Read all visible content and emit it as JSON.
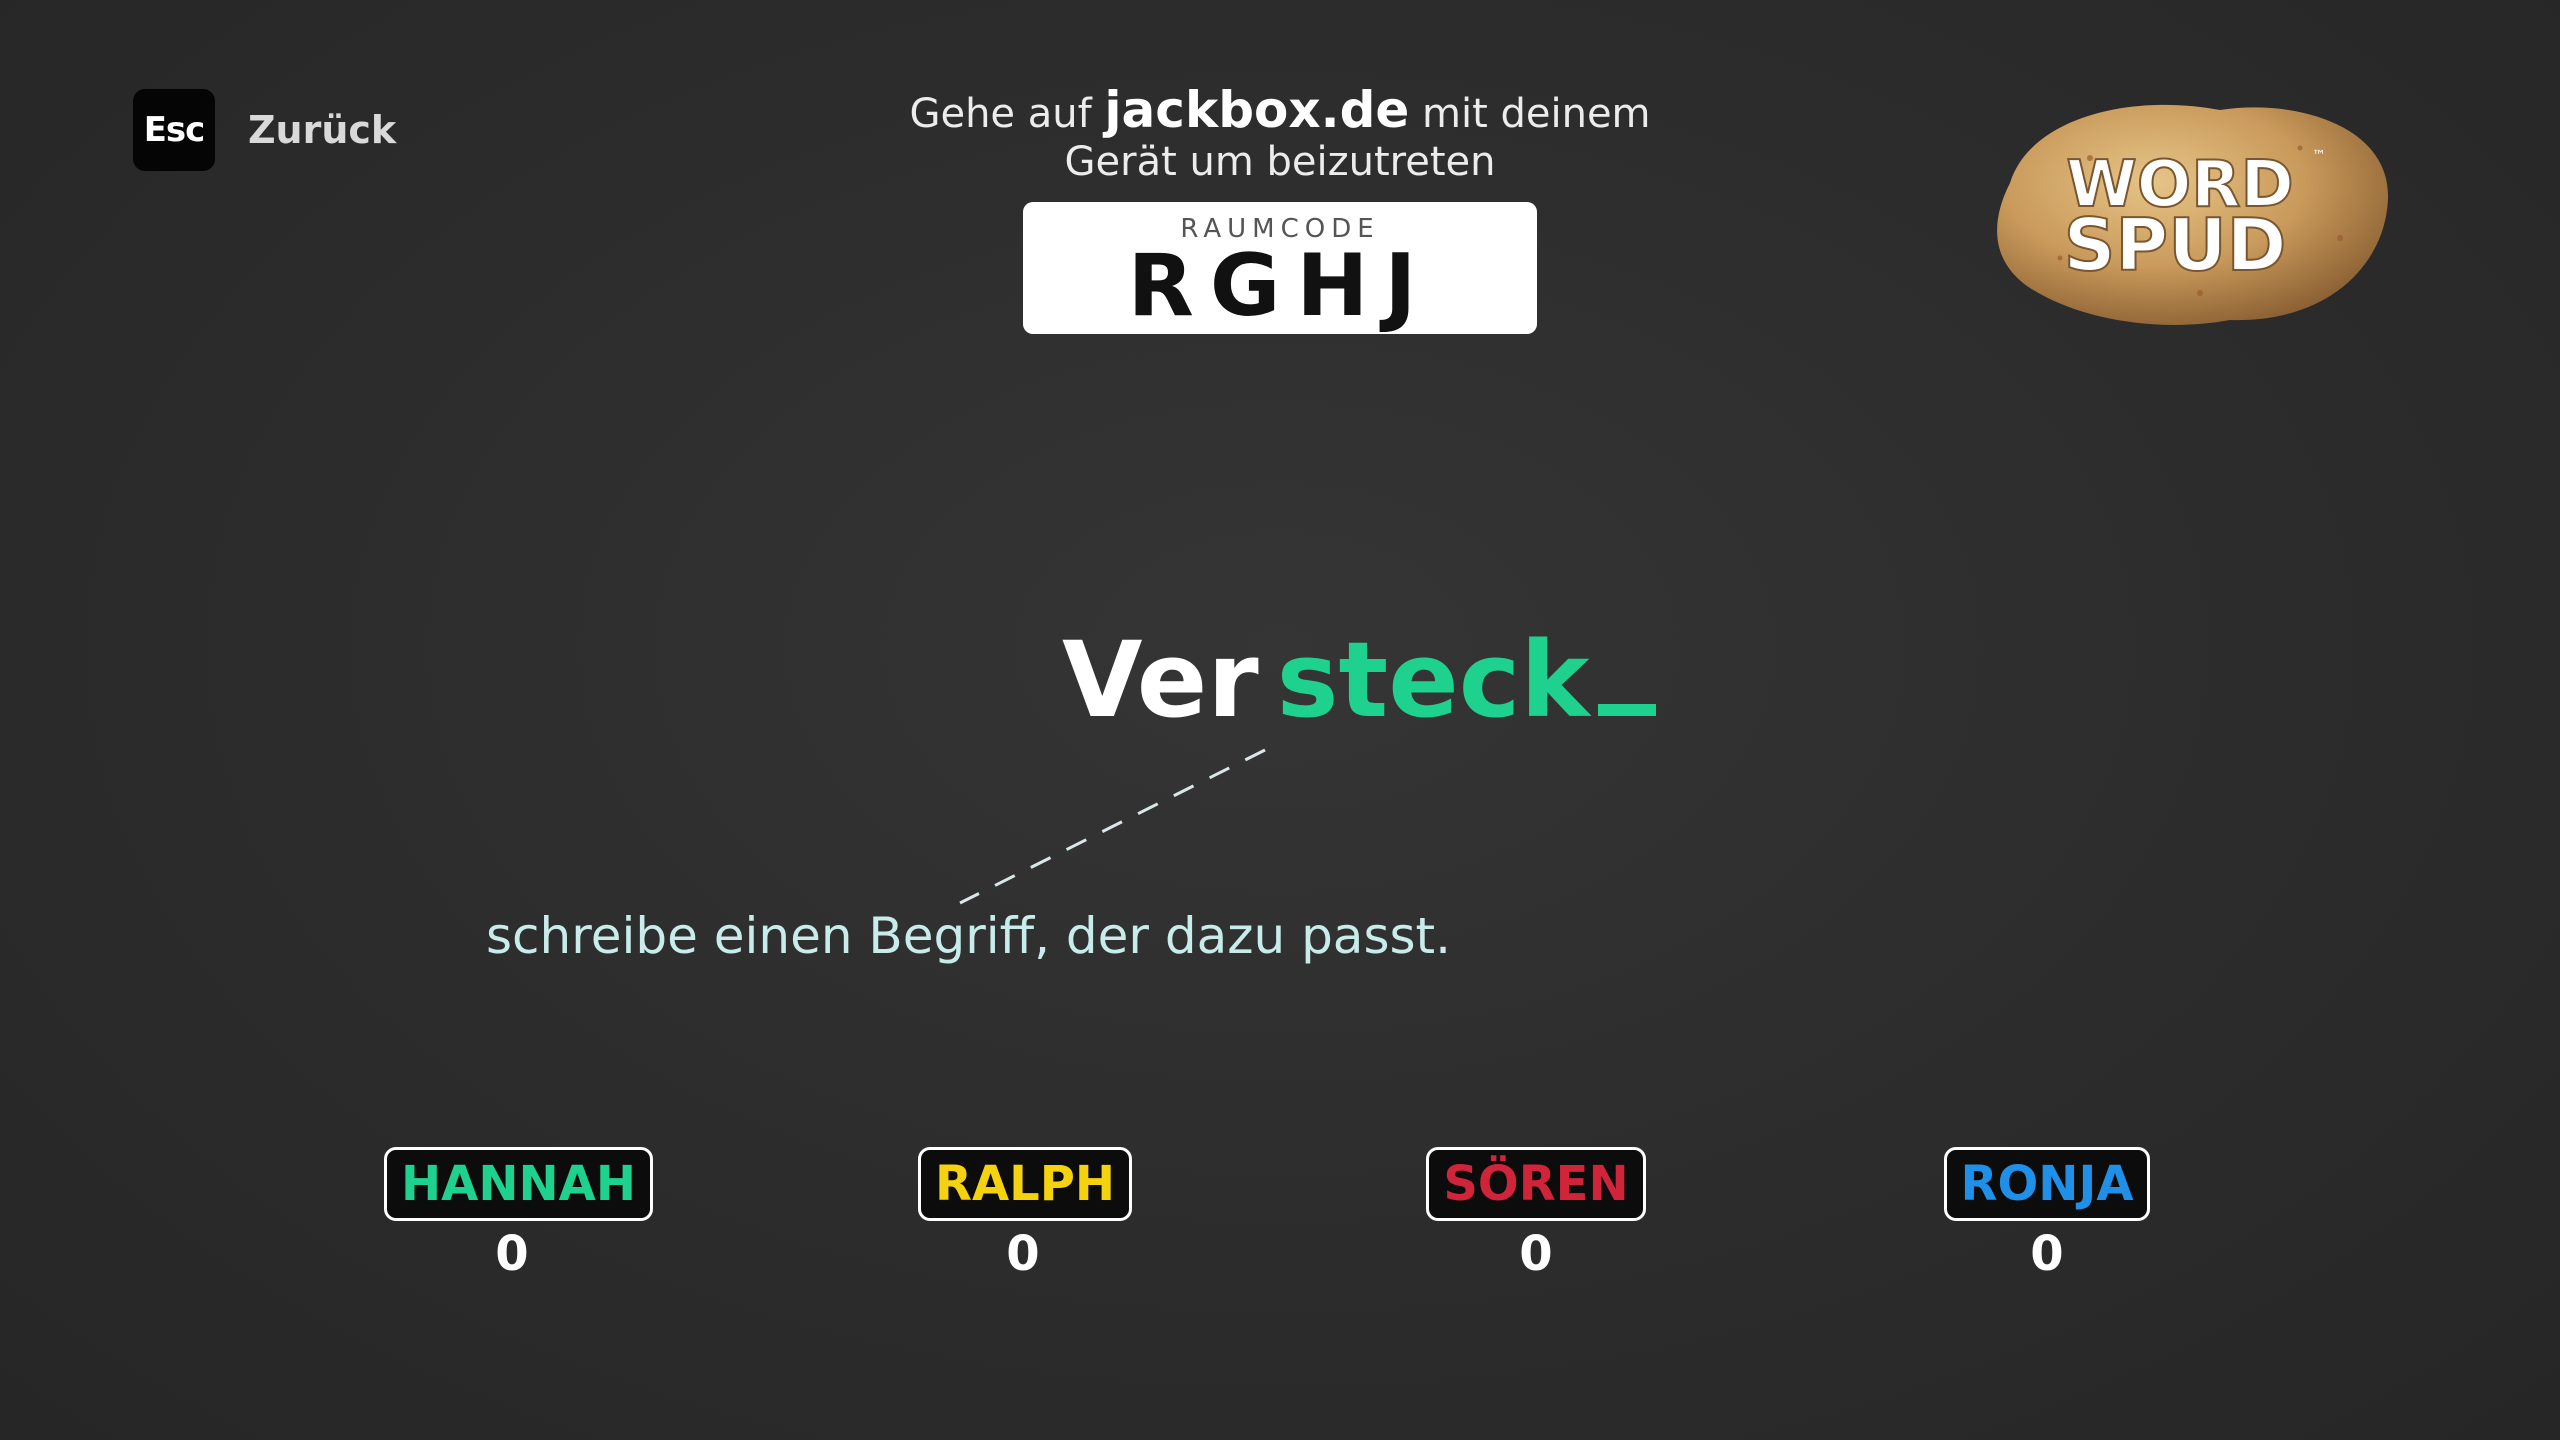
{
  "nav": {
    "key_label": "Esc",
    "back_label": "Zurück"
  },
  "join": {
    "prefix": "Gehe auf",
    "site": "jackbox.de",
    "suffix": "mit deinem",
    "line2": "Gerät um beizutreten",
    "room_label": "RAUMCODE",
    "room_code": "RGHJ"
  },
  "logo": {
    "line1": "WORD",
    "line2": "SPUD",
    "tm": "™"
  },
  "prompt": {
    "fixed_part": "Ver",
    "typed_part": "steck",
    "hint": "schreibe einen Begriff, der dazu passt.",
    "accent_color": "#1fd18e"
  },
  "players": [
    {
      "name": "HANNAH",
      "score": "0",
      "color": "#1fd18e"
    },
    {
      "name": "RALPH",
      "score": "0",
      "color": "#f5d20f"
    },
    {
      "name": "SÖREN",
      "score": "0",
      "color": "#d0243a"
    },
    {
      "name": "RONJA",
      "score": "0",
      "color": "#1f8fe8"
    }
  ]
}
